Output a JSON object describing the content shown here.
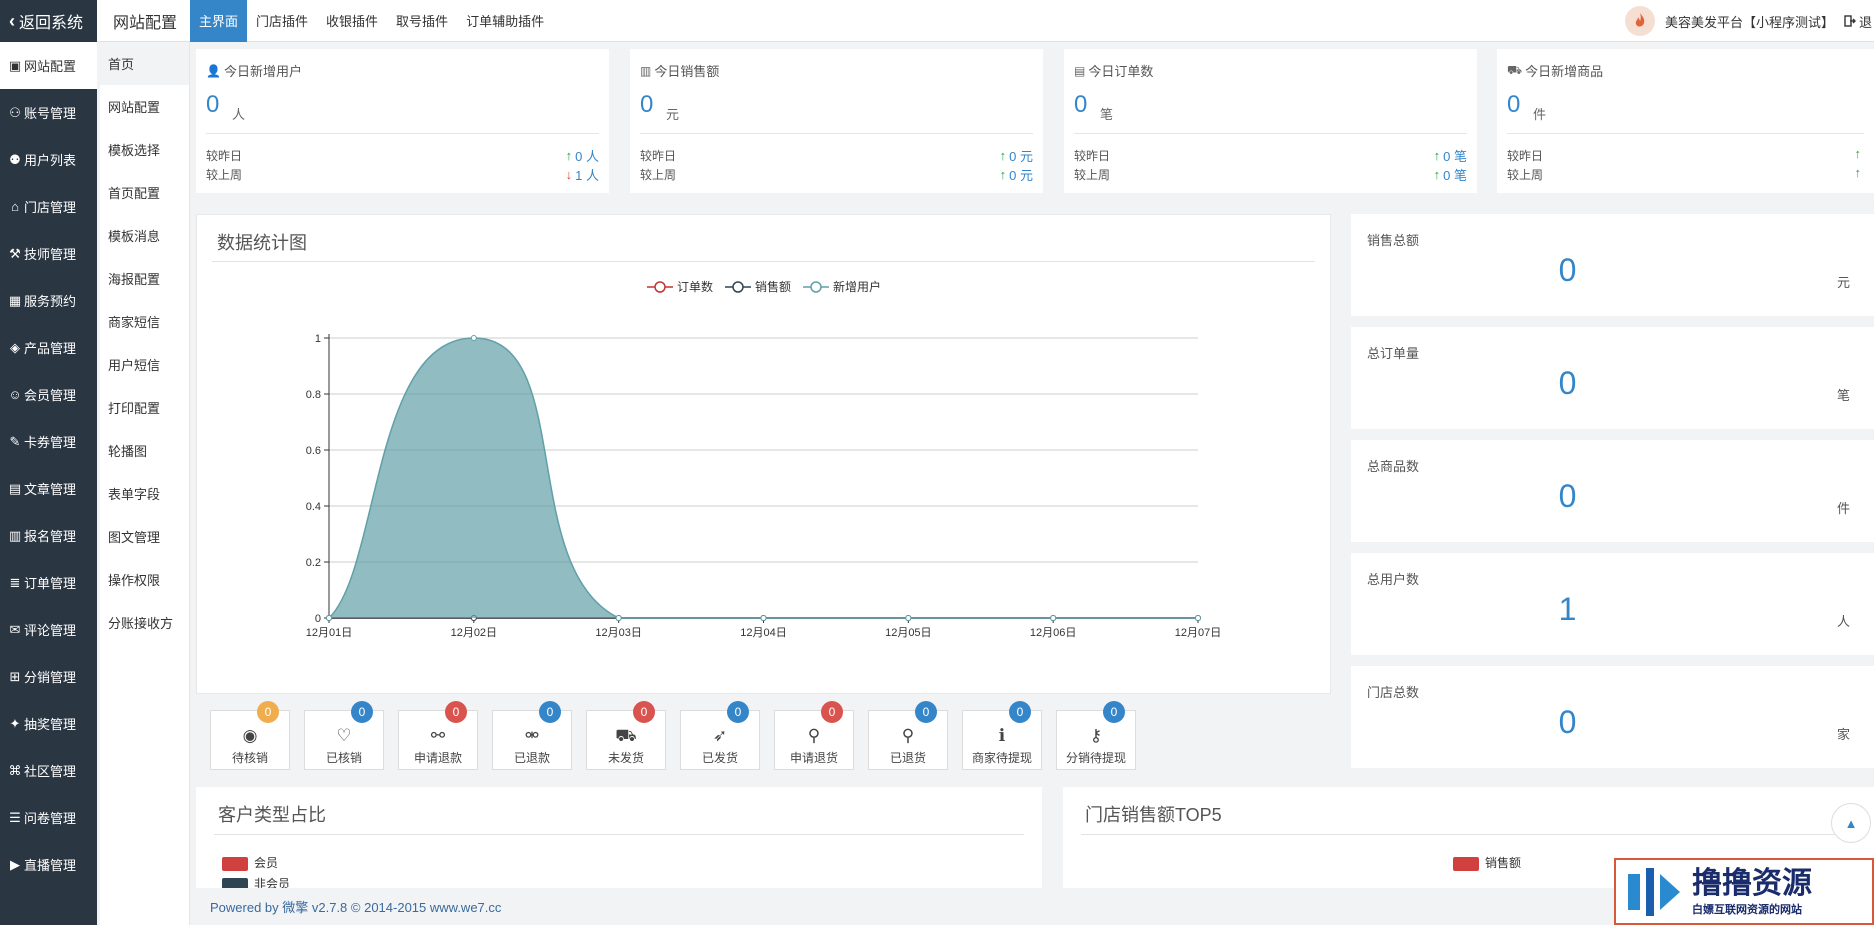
{
  "sidebar": {
    "back_label": "返回系统",
    "items": [
      {
        "label": "网站配置",
        "icon": "monitor-icon"
      },
      {
        "label": "账号管理",
        "icon": "user-gear-icon"
      },
      {
        "label": "用户列表",
        "icon": "users-icon"
      },
      {
        "label": "门店管理",
        "icon": "store-icon"
      },
      {
        "label": "技师管理",
        "icon": "tech-user-icon"
      },
      {
        "label": "服务预约",
        "icon": "calendar-icon"
      },
      {
        "label": "产品管理",
        "icon": "product-icon"
      },
      {
        "label": "会员管理",
        "icon": "member-icon"
      },
      {
        "label": "卡券管理",
        "icon": "ticket-icon"
      },
      {
        "label": "文章管理",
        "icon": "article-icon"
      },
      {
        "label": "报名管理",
        "icon": "signup-icon"
      },
      {
        "label": "订单管理",
        "icon": "order-icon"
      },
      {
        "label": "评论管理",
        "icon": "comment-icon"
      },
      {
        "label": "分销管理",
        "icon": "sitemap-icon"
      },
      {
        "label": "抽奖管理",
        "icon": "lottery-icon"
      },
      {
        "label": "社区管理",
        "icon": "community-icon"
      },
      {
        "label": "问卷管理",
        "icon": "survey-icon"
      },
      {
        "label": "直播管理",
        "icon": "live-icon"
      }
    ]
  },
  "subnav": {
    "items": [
      "首页",
      "网站配置",
      "模板选择",
      "首页配置",
      "模板消息",
      "海报配置",
      "商家短信",
      "用户短信",
      "打印配置",
      "轮播图",
      "表单字段",
      "图文管理",
      "操作权限",
      "分账接收方"
    ]
  },
  "topbar": {
    "brand": "网站配置",
    "tabs": [
      "主界面",
      "门店插件",
      "收银插件",
      "取号插件",
      "订单辅助插件"
    ],
    "platform": "美容美发平台【小程序测试】",
    "logout": "退"
  },
  "stats": [
    {
      "title": "今日新增用户",
      "value": "0",
      "unit": "人",
      "r1_label": "较昨日",
      "r1_value": "0 人",
      "r1_dir": "up",
      "r2_label": "较上周",
      "r2_value": "1 人",
      "r2_dir": "down",
      "icon": "user-icon"
    },
    {
      "title": "今日销售额",
      "value": "0",
      "unit": "元",
      "r1_label": "较昨日",
      "r1_value": "0 元",
      "r1_dir": "up",
      "r2_label": "较上周",
      "r2_value": "0 元",
      "r2_dir": "up",
      "icon": "bar-chart-icon"
    },
    {
      "title": "今日订单数",
      "value": "0",
      "unit": "笔",
      "r1_label": "较昨日",
      "r1_value": "0 笔",
      "r1_dir": "up",
      "r2_label": "较上周",
      "r2_value": "0 笔",
      "r2_dir": "up",
      "icon": "file-icon"
    },
    {
      "title": "今日新增商品",
      "value": "0",
      "unit": "件",
      "r1_label": "较昨日",
      "r1_value": "",
      "r1_dir": "up",
      "r2_label": "较上周",
      "r2_value": "",
      "r2_dir": "up",
      "icon": "cart-icon"
    }
  ],
  "chart_panel": {
    "title": "数据统计图"
  },
  "chart_data": {
    "type": "area",
    "categories": [
      "12月01日",
      "12月02日",
      "12月03日",
      "12月04日",
      "12月05日",
      "12月06日",
      "12月07日"
    ],
    "series": [
      {
        "name": "订单数",
        "values": [
          0,
          0,
          0,
          0,
          0,
          0,
          0
        ],
        "color": "#c23531"
      },
      {
        "name": "销售额",
        "values": [
          0,
          0,
          0,
          0,
          0,
          0,
          0
        ],
        "color": "#2f4554"
      },
      {
        "name": "新增用户",
        "values": [
          0,
          1,
          0,
          0,
          0,
          0,
          0
        ],
        "color": "#61a0a8"
      }
    ],
    "ylim": [
      0,
      1
    ],
    "yticks": [
      "0",
      "0.2",
      "0.4",
      "0.6",
      "0.8",
      "1"
    ],
    "grid": true,
    "legend": "top-center"
  },
  "summary": [
    {
      "title": "销售总额",
      "value": "0",
      "unit": "元"
    },
    {
      "title": "总订单量",
      "value": "0",
      "unit": "笔"
    },
    {
      "title": "总商品数",
      "value": "0",
      "unit": "件"
    },
    {
      "title": "总用户数",
      "value": "1",
      "unit": "人"
    },
    {
      "title": "门店总数",
      "value": "0",
      "unit": "家"
    }
  ],
  "order_status": [
    {
      "label": "待核销",
      "count": "0",
      "badge_color": "#f0ad4e",
      "icon": "eye-icon"
    },
    {
      "label": "已核销",
      "count": "0",
      "badge_color": "#3586c9",
      "icon": "heart-icon"
    },
    {
      "label": "申请退款",
      "count": "0",
      "badge_color": "#d9534f",
      "icon": "link-icon"
    },
    {
      "label": "已退款",
      "count": "0",
      "badge_color": "#3586c9",
      "icon": "unlink-icon"
    },
    {
      "label": "未发货",
      "count": "0",
      "badge_color": "#d9534f",
      "icon": "truck-icon"
    },
    {
      "label": "已发货",
      "count": "0",
      "badge_color": "#3586c9",
      "icon": "rocket-icon"
    },
    {
      "label": "申请退货",
      "count": "0",
      "badge_color": "#d9534f",
      "icon": "bicycle-icon"
    },
    {
      "label": "已退货",
      "count": "0",
      "badge_color": "#3586c9",
      "icon": "motorcycle-icon"
    },
    {
      "label": "商家待提现",
      "count": "0",
      "badge_color": "#3586c9",
      "icon": "info-icon"
    },
    {
      "label": "分销待提现",
      "count": "0",
      "badge_color": "#3586c9",
      "icon": "key-icon"
    }
  ],
  "customer_panel": {
    "title": "客户类型占比",
    "legend": [
      "会员",
      "非会员"
    ]
  },
  "store_panel": {
    "title": "门店销售额TOP5",
    "legend": [
      "销售额"
    ]
  },
  "footer": "Powered by 微擎 v2.7.8 © 2014-2015 www.we7.cc",
  "watermark": {
    "main": "撸撸资源",
    "sub": "白嫖互联网资源的网站"
  },
  "accent_color": "#3586c9"
}
